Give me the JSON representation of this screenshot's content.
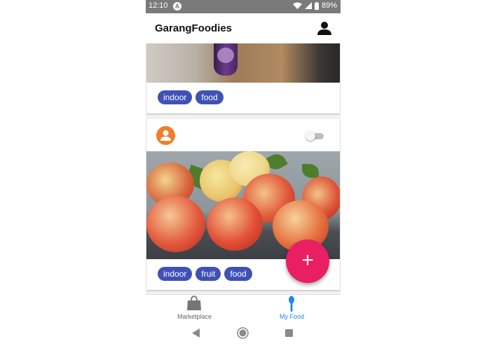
{
  "status_bar": {
    "time": "12:10",
    "notification_letter": "A",
    "battery": "89%"
  },
  "app_bar": {
    "title": "GarangFoodies",
    "profile_icon": "person-icon"
  },
  "cards": [
    {
      "tags": [
        "indoor",
        "food"
      ]
    },
    {
      "avatar_icon": "person-icon",
      "toggle_on": false,
      "tags": [
        "indoor",
        "fruit",
        "food"
      ]
    }
  ],
  "fab": {
    "label": "+"
  },
  "bottom_nav": {
    "items": [
      {
        "label": "Marketplace",
        "icon": "shopping-bag-icon"
      },
      {
        "label": "My Food",
        "icon": "spoon-icon"
      }
    ]
  },
  "colors": {
    "tag": "#3f51b5",
    "fab": "#e91e63",
    "avatar": "#f07f2b",
    "active_nav": "#1e88e5"
  }
}
